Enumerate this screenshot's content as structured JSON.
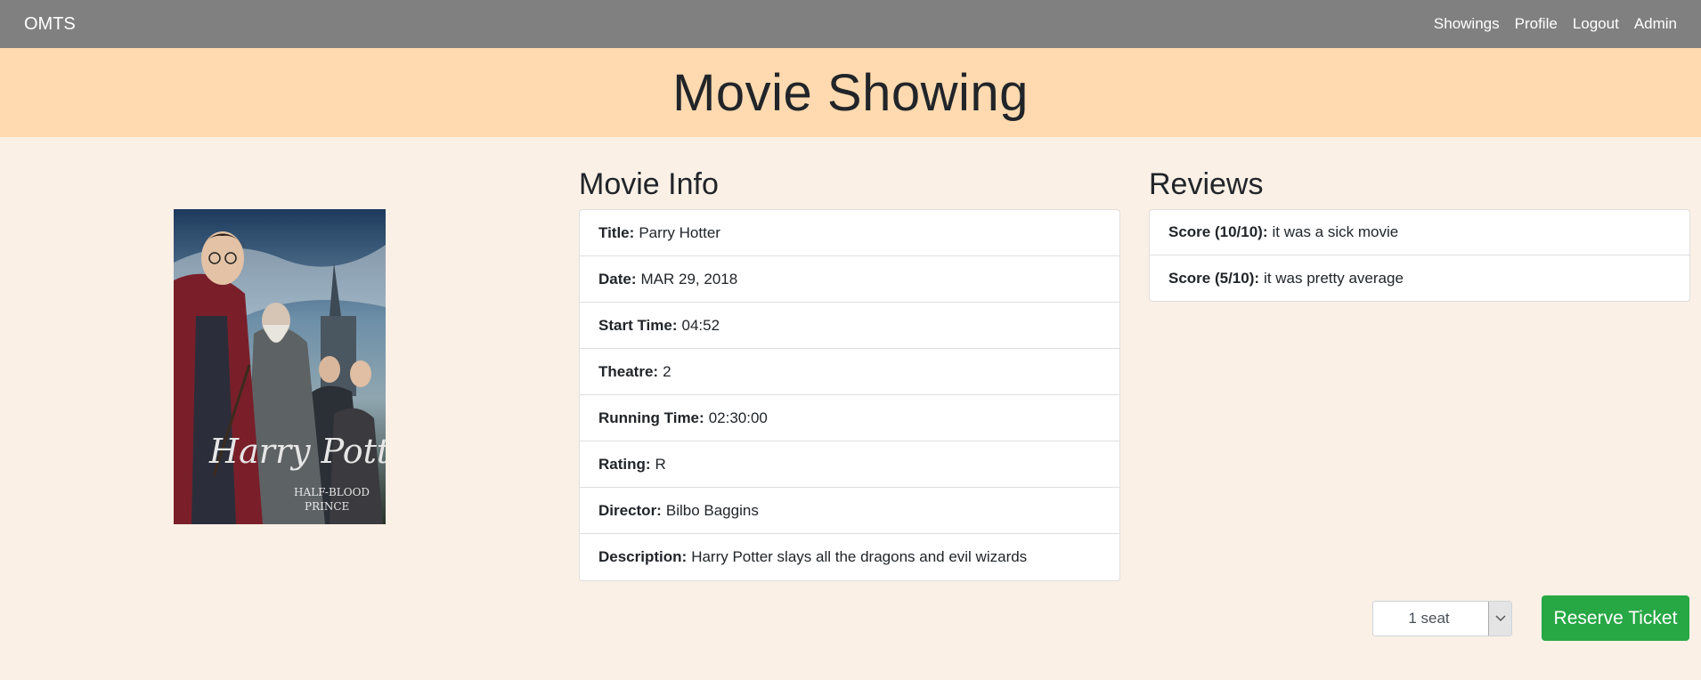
{
  "navbar": {
    "brand": "OMTS",
    "links": [
      "Showings",
      "Profile",
      "Logout",
      "Admin"
    ]
  },
  "header": {
    "title": "Movie Showing"
  },
  "poster": {
    "title_line1": "Harry Potter",
    "title_line2": "HALF-BLOOD",
    "title_line3": "PRINCE"
  },
  "movie_info": {
    "heading": "Movie Info",
    "items": [
      {
        "label": "Title:",
        "value": "Parry Hotter"
      },
      {
        "label": "Date:",
        "value": "MAR 29, 2018"
      },
      {
        "label": "Start Time:",
        "value": "04:52"
      },
      {
        "label": "Theatre:",
        "value": "2"
      },
      {
        "label": "Running Time:",
        "value": "02:30:00"
      },
      {
        "label": "Rating:",
        "value": "R"
      },
      {
        "label": "Director:",
        "value": "Bilbo Baggins"
      },
      {
        "label": "Description:",
        "value": "Harry Potter slays all the dragons and evil wizards"
      }
    ]
  },
  "reviews": {
    "heading": "Reviews",
    "items": [
      {
        "label": "Score (10/10):",
        "value": "it was a sick movie"
      },
      {
        "label": "Score (5/10):",
        "value": "it was pretty average"
      }
    ]
  },
  "reservation": {
    "seat_selected": "1 seat",
    "reserve_label": "Reserve Ticket"
  },
  "colors": {
    "navbar": "#808080",
    "header": "#ffdab0",
    "background": "#faf0e6",
    "button": "#28a745"
  },
  "icons": {
    "select_arrow": "chevron-down-icon"
  }
}
